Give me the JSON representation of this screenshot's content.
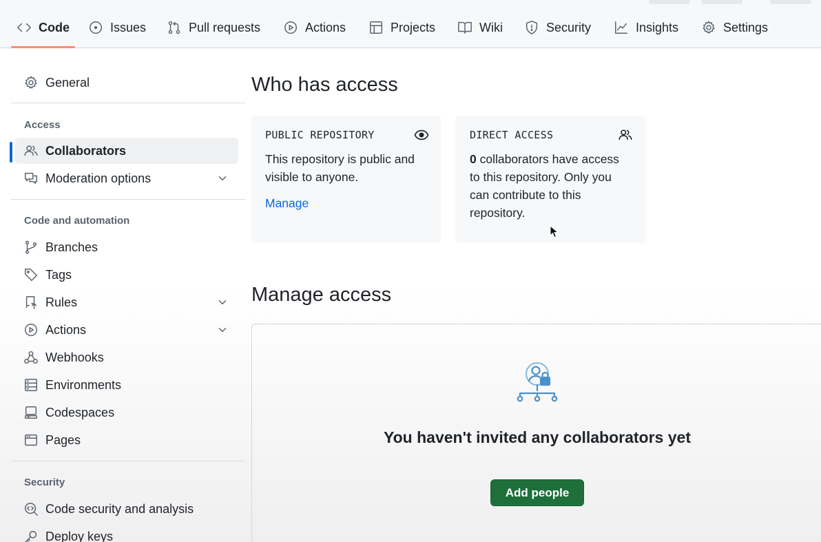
{
  "tabs": [
    {
      "label": "Code",
      "icon": "code-icon",
      "selected": true
    },
    {
      "label": "Issues",
      "icon": "issue-opened-icon"
    },
    {
      "label": "Pull requests",
      "icon": "git-pull-request-icon"
    },
    {
      "label": "Actions",
      "icon": "play-icon"
    },
    {
      "label": "Projects",
      "icon": "table-icon"
    },
    {
      "label": "Wiki",
      "icon": "book-icon"
    },
    {
      "label": "Security",
      "icon": "shield-icon"
    },
    {
      "label": "Insights",
      "icon": "graph-icon"
    },
    {
      "label": "Settings",
      "icon": "gear-icon"
    }
  ],
  "sidebar": {
    "general": "General",
    "groups": {
      "access": "Access",
      "code_automation": "Code and automation",
      "security": "Security"
    },
    "items": {
      "collaborators": "Collaborators",
      "moderation": "Moderation options",
      "branches": "Branches",
      "tags": "Tags",
      "rules": "Rules",
      "actions": "Actions",
      "webhooks": "Webhooks",
      "environments": "Environments",
      "codespaces": "Codespaces",
      "pages": "Pages",
      "code_security": "Code security and analysis",
      "deploy_keys": "Deploy keys"
    }
  },
  "main": {
    "who_has_access": "Who has access",
    "public_card": {
      "title": "PUBLIC REPOSITORY",
      "line1": "This repository is public and",
      "line2": "visible to anyone.",
      "link": "Manage"
    },
    "direct_card": {
      "title": "DIRECT ACCESS",
      "count": "0",
      "line1_rest": " collaborators have access",
      "line2": "to this repository. Only you",
      "line3": "can contribute to this",
      "line4": "repository."
    },
    "manage_access": "Manage access",
    "empty_title": "You haven't invited any collaborators yet",
    "add_button": "Add people"
  },
  "colors": {
    "primary_button": "#1f6f3b",
    "link": "#0969da",
    "active_indicator": "#0969da",
    "tab_underline": "#fd8c73"
  }
}
